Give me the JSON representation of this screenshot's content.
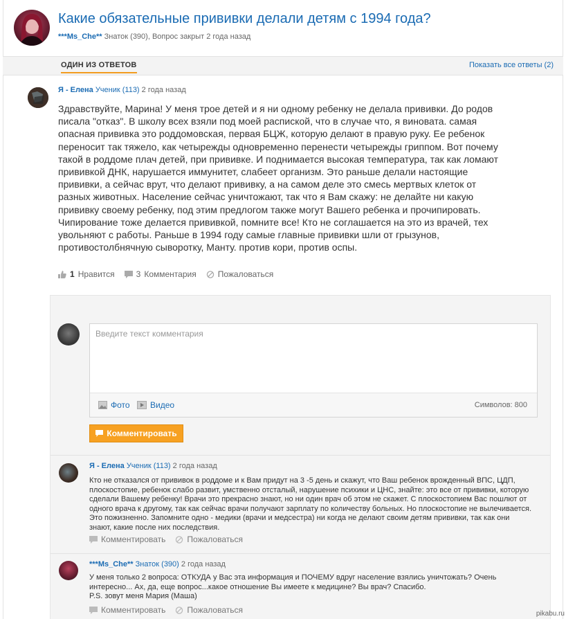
{
  "question": {
    "title": "Какие обязательные прививки делали детям с 1994 года?",
    "author": "***Ms_Che**",
    "meta": "Знаток (390), Вопрос закрыт 2 года назад"
  },
  "tabs": {
    "active": "ОДИН ИЗ ОТВЕТОВ",
    "show_all": "Показать все ответы (2)"
  },
  "answer": {
    "author": "Я - Елена",
    "rank": "Ученик (113)",
    "time": "2 года назад",
    "text": "Здравствуйте, Марина! У меня трое детей и я ни одному ребенку не делала прививки. До родов писала \"отказ\". В школу всех взяли под моей распиской, что в случае что, я виновата. самая опасная прививка это роддомовская, первая БЦЖ, которую делают в правую руку. Ее ребенок переносит так тяжело, как четырежды одновременно перенести четырежды гриппом. Вот почему такой в роддоме плач детей, при прививке. И поднимается высокая температура, так как ломают прививкой ДНК, нарушается иммунитет, слабеет организм. Это раньше делали настоящие прививки, а сейчас врут, что делают прививку, а на самом деле это смесь мертвых клеток от разных животных. Население сейчас уничтожают, так что я Вам скажу: не делайте ни какую прививку своему ребенку, под этим предлогом также могут Вашего ребенка и прочипировать. Чипирование тоже делается прививкой, помните все! Кто не соглашается на это из врачей, тех увольняют с работы. Раньше в 1994 году самые главные прививки шли от грызунов, противостолбнячную сыворотку, Манту. против кори, против оспы.",
    "likes_count": "1",
    "likes_label": "Нравится",
    "comments_count": "3",
    "comments_label": "Комментария",
    "report_label": "Пожаловаться"
  },
  "comment_form": {
    "placeholder": "Введите текст комментария",
    "photo_label": "Фото",
    "video_label": "Видео",
    "symbols": "Символов: 800",
    "submit_label": "Комментировать"
  },
  "comments": [
    {
      "author": "Я - Елена",
      "rank": "Ученик (113)",
      "time": "2 года назад",
      "text": "Кто не отказался от прививок в роддоме и к Вам придут на 3 -5 день и скажут, что Ваш ребенок врожденный ВПС, ЦДП, плоскостопие, ребенок слабо развит, умственно отсталый, нарушение психики и ЦНС, знайте: это все от прививки, которую сделали Вашему ребенку! Врачи это прекрасно знают, но ни один врач об этом не скажет. С плоскостопием Вас пошлют от одного врача к другому, так как сейчас врачи получают зарплату по количеству больных. Но плоскостопие не вылечивается. Это пожизненно. Запомните одно - медики (врачи и медсестра) ни когда не делают своим детям прививки, так как они знают, какие после них последствия.",
      "reply_label": "Комментировать",
      "report_label": "Пожаловаться"
    },
    {
      "author": "***Ms_Che**",
      "rank": "Знаток (390)",
      "time": "2 года назад",
      "text_line1": "У меня только 2 вопроса: ОТКУДА у Вас эта информация и ПОЧЕМУ вдруг население взялись уничтожать? Очень интересно... Ах, да, еще вопрос...какое отношение Вы имеете к медицине? Вы врач? Спасибо.",
      "text_line2": "P.S. зовут меня Мария (Маша)",
      "reply_label": "Комментировать",
      "report_label": "Пожаловаться"
    }
  ],
  "watermark": "pikabu.ru",
  "colors": {
    "link": "#1a6bb3",
    "accent": "#f7a122",
    "panel_bg": "#f4f4f4"
  }
}
